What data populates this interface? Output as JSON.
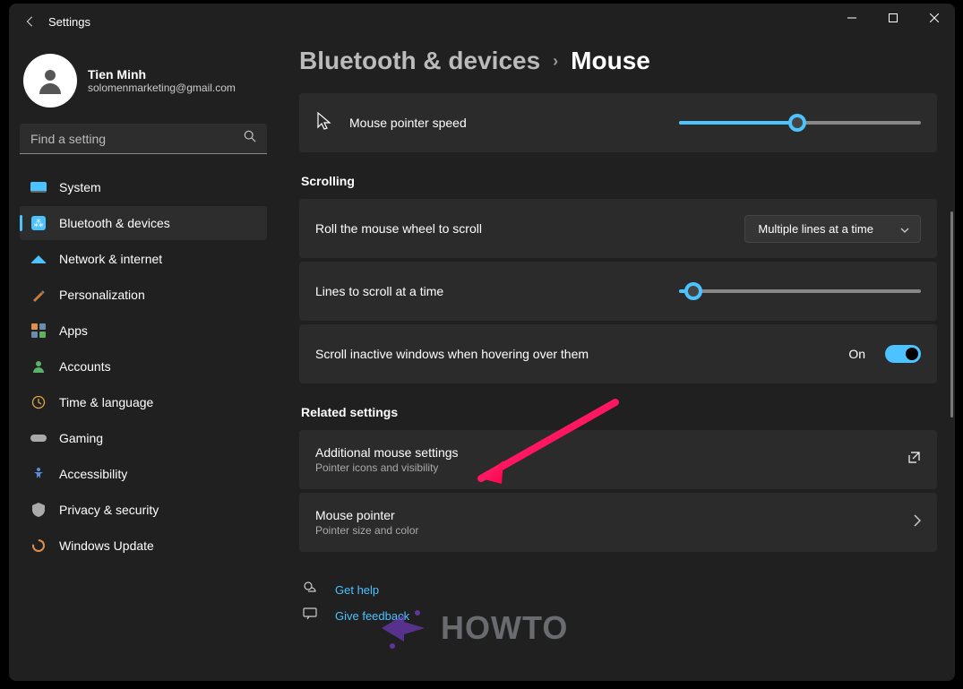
{
  "window": {
    "title": "Settings"
  },
  "profile": {
    "name": "Tien Minh",
    "email": "solomenmarketing@gmail.com"
  },
  "search": {
    "placeholder": "Find a setting"
  },
  "sidebar": {
    "items": [
      {
        "label": "System"
      },
      {
        "label": "Bluetooth & devices"
      },
      {
        "label": "Network & internet"
      },
      {
        "label": "Personalization"
      },
      {
        "label": "Apps"
      },
      {
        "label": "Accounts"
      },
      {
        "label": "Time & language"
      },
      {
        "label": "Gaming"
      },
      {
        "label": "Accessibility"
      },
      {
        "label": "Privacy & security"
      },
      {
        "label": "Windows Update"
      }
    ]
  },
  "breadcrumb": {
    "parent": "Bluetooth & devices",
    "current": "Mouse"
  },
  "settings": {
    "pointerSpeed": {
      "label": "Mouse pointer speed",
      "value_pct": 49
    },
    "scrollingHeader": "Scrolling",
    "rollWheel": {
      "label": "Roll the mouse wheel to scroll",
      "value": "Multiple lines at a time"
    },
    "linesToScroll": {
      "label": "Lines to scroll at a time",
      "value_pct": 6
    },
    "inactiveScroll": {
      "label": "Scroll inactive windows when hovering over them",
      "state_label": "On",
      "on": true
    },
    "relatedHeader": "Related settings",
    "additional": {
      "title": "Additional mouse settings",
      "sub": "Pointer icons and visibility"
    },
    "mousePointer": {
      "title": "Mouse pointer",
      "sub": "Pointer size and color"
    }
  },
  "footer": {
    "help": "Get help",
    "feedback": "Give feedback"
  },
  "watermark": "HOWTO"
}
